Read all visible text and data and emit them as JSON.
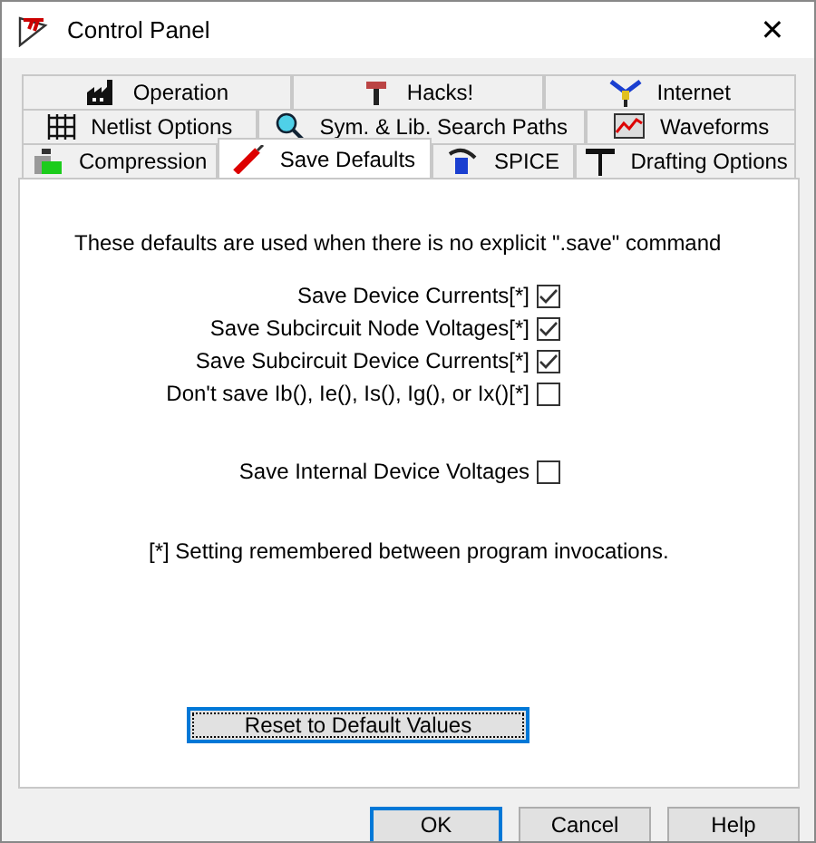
{
  "window": {
    "title": "Control Panel",
    "close": "✕"
  },
  "tab_rows": [
    [
      {
        "label": "Operation",
        "selected": false
      },
      {
        "label": "Hacks!",
        "selected": false
      },
      {
        "label": "Internet",
        "selected": false
      }
    ],
    [
      {
        "label": "Netlist Options",
        "selected": false
      },
      {
        "label": "Sym. & Lib. Search Paths",
        "selected": false
      },
      {
        "label": "Waveforms",
        "selected": false
      }
    ],
    [
      {
        "label": "Compression",
        "selected": false
      },
      {
        "label": "Save Defaults",
        "selected": true
      },
      {
        "label": "SPICE",
        "selected": false
      },
      {
        "label": "Drafting Options",
        "selected": false
      }
    ]
  ],
  "intro": "These defaults are used when there is no explicit \".save\" command",
  "options": [
    {
      "label": "Save Device Currents[*]",
      "checked": true
    },
    {
      "label": "Save Subcircuit Node Voltages[*]",
      "checked": true
    },
    {
      "label": "Save Subcircuit Device Currents[*]",
      "checked": true
    },
    {
      "label": "Don't save Ib(), Ie(), Is(), Ig(), or Ix()[*]",
      "checked": false
    }
  ],
  "extra_option": {
    "label": "Save Internal Device Voltages",
    "checked": false
  },
  "note": "[*] Setting remembered between program invocations.",
  "reset_button": "Reset to Default Values",
  "buttons": [
    {
      "label": "OK",
      "default": true
    },
    {
      "label": "Cancel",
      "default": false
    },
    {
      "label": "Help",
      "default": false
    }
  ]
}
